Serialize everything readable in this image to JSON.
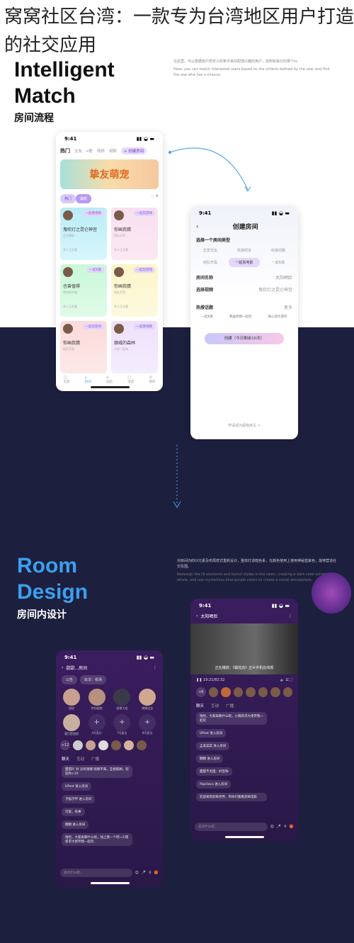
{
  "headline": "窝窝社区台湾：一款专为台湾地区用户打造的社交应用",
  "section1": {
    "title_en_1": "Intelligent",
    "title_en_2": "Match",
    "title_cn": "房间流程",
    "desc_cn": "在这里，可以根据用户所定义的条件来匹配感兴趣的用户，找到有缘分的那个ta",
    "desc_en": "Here, you can match interested users based on the criteria defined by the user and find the one who has a chance."
  },
  "section2": {
    "title_en_1": "Room",
    "title_en_2": "Design",
    "title_cn": "房间内设计",
    "desc_cn": "对房间内的UI元素及布局样式重新设计，整体打造暗色系，在颜色使用上使用神秘蓝紫色，能够营造社交氛围。",
    "desc_en": "Redesign the UI elements and layout styles in the room, creating a dark color scheme as a whole, and use mysterious blue purple colors to create a social atmosphere."
  },
  "colors": {
    "accent_blue": "#3aa0f0",
    "dark_bg": "#1d1f3e",
    "purple": "#8a5bd8"
  },
  "time": "9:41",
  "home": {
    "tabs": [
      "热门",
      "交友",
      "k歌",
      "视频",
      "闲聊"
    ],
    "create_btn": "+ 创建房间",
    "banner": "挚友萌宠",
    "filters": [
      "热门",
      "最新"
    ],
    "cards": [
      {
        "title": "鬼吹灯之昆仑神宫",
        "tag": "一起看视频",
        "sub": "正在播放",
        "count": "多人正在看"
      },
      {
        "title": "你画我猜",
        "tag": "一起玩游戏",
        "sub": "组队开黑",
        "count": "多人正在看"
      },
      {
        "title": "也曾值得",
        "tag": "一起K歌",
        "sub": "等待你开唱",
        "count": "多人正在看"
      },
      {
        "title": "你画我猜",
        "tag": "一起玩游戏",
        "sub": "组队开黑",
        "count": "多人正在看"
      },
      {
        "title": "你画我猜",
        "tag": "一起玩游戏",
        "sub": "组队开黑",
        "count": "多人正在看"
      },
      {
        "title": "挪威的森林",
        "tag": "一起看视频",
        "sub": "大部一起来",
        "count": "多人正在看"
      }
    ],
    "nav": [
      "交友",
      "房间",
      "动态",
      "消息",
      "我的"
    ]
  },
  "create": {
    "title": "创建房间",
    "section": "选择一个房间类型",
    "types": [
      "恋爱交友",
      "情感倾诉",
      "听歌闲聊",
      "组队开黑",
      "一起看电影",
      "一起K歌"
    ],
    "name_label": "房间名称",
    "name_value": "太阳晒脸",
    "video_label": "选择视频",
    "video_value": "鬼吹灯之昆仑神宫",
    "topic_label": "热搜话题",
    "topic_more": "更多",
    "topics": [
      "一起K歌",
      "我画你猜一起玩",
      "真心话大冒险"
    ],
    "button": "创建（今日剩余10次）",
    "footer": "申请成为超级房主 >"
  },
  "video_room": {
    "room_name": "太阳晒脸",
    "banner": "正在播放：《霜花店》正片手机在线观",
    "time": "19:21/82:32",
    "online": "+6",
    "tabs": [
      "聊天",
      "互动",
      "广播"
    ],
    "messages": [
      "哈哈，大家再聊什么呢，小萌新求大佬带我一起玩",
      "UPset 进入房间",
      "孟美菜菜 进入房间",
      "糖糖 进入房间",
      "甜甜不尤困：好恐怖",
      "Papillaca 进入房间",
      "欢迎来到恐怖世界，带你们看看恐怖电影"
    ],
    "input": "说点什么吧..."
  },
  "voice_room": {
    "room_name": "甜甜...房间",
    "tags": [
      "公告",
      "玩法：看场"
    ],
    "seats": [
      "甜甜",
      "特别甜甜",
      "甜蜜大姐",
      "摸摸宝宝",
      "我们是甜甜",
      "4号麦位",
      "7号麦位",
      "8号麦位"
    ],
    "online": "+12",
    "tabs": [
      "聊天",
      "互动",
      "广播"
    ],
    "messages": [
      "甜甜吖 对 没有钱哪 刚刚不来，互相照顾，欢迎你+10",
      "UPset 进入房间",
      "子猫子伴 进入房间",
      "可爱，有事",
      "糖糖 进入房间",
      "哈哈，大家再聊什么呢，加上我一个吧~小萌新求大佬带我一起玩"
    ],
    "input": "说点什么吧..."
  }
}
